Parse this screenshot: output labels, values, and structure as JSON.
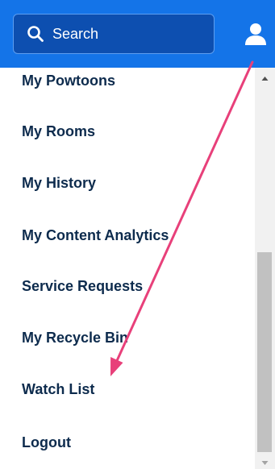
{
  "header": {
    "search": {
      "placeholder": "Search",
      "value": ""
    },
    "search_icon": "search-icon",
    "user_icon": "user-icon",
    "background_color": "#1474e8"
  },
  "menu": {
    "items": [
      {
        "label": "My Powtoons"
      },
      {
        "label": "My Rooms"
      },
      {
        "label": "My History"
      },
      {
        "label": "My Content Analytics"
      },
      {
        "label": "Service Requests"
      },
      {
        "label": "My Recycle Bin"
      },
      {
        "label": "Watch List"
      },
      {
        "label": "Logout"
      }
    ],
    "text_color": "#0d2b4d"
  },
  "annotation": {
    "arrow_color": "#e8407a"
  }
}
